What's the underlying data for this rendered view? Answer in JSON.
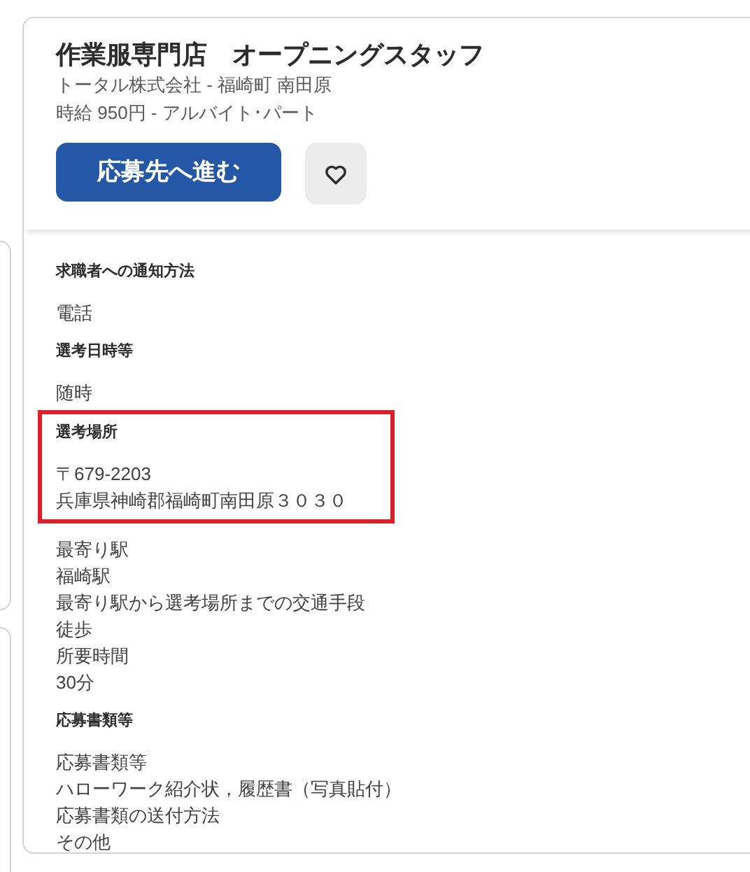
{
  "header": {
    "title": "作業服専門店　オープニングスタッフ",
    "company_location": "トータル株式会社 - 福崎町 南田原",
    "pay_type": "時給 950円 - アルバイト･パート",
    "apply_button": "応募先へ進む",
    "favorite": {
      "saved": false
    }
  },
  "sections": [
    {
      "heading": "求職者への通知方法",
      "lines": [
        "電話"
      ],
      "highlighted": false
    },
    {
      "heading": "選考日時等",
      "lines": [
        "随時"
      ],
      "highlighted": false
    },
    {
      "heading": "選考場所",
      "lines": [
        "〒679-2203",
        "兵庫県神崎郡福崎町南田原３０３０"
      ],
      "highlighted": true
    },
    {
      "lines": [
        "最寄り駅",
        "福崎駅",
        "最寄り駅から選考場所までの交通手段",
        "徒歩",
        "所要時間",
        "30分"
      ],
      "highlighted": false
    },
    {
      "heading": "応募書類等",
      "lines": [
        "応募書類等",
        "ハローワーク紹介状，履歴書（写真貼付）",
        "応募書類の送付方法",
        "その他"
      ],
      "highlighted": false
    }
  ]
}
